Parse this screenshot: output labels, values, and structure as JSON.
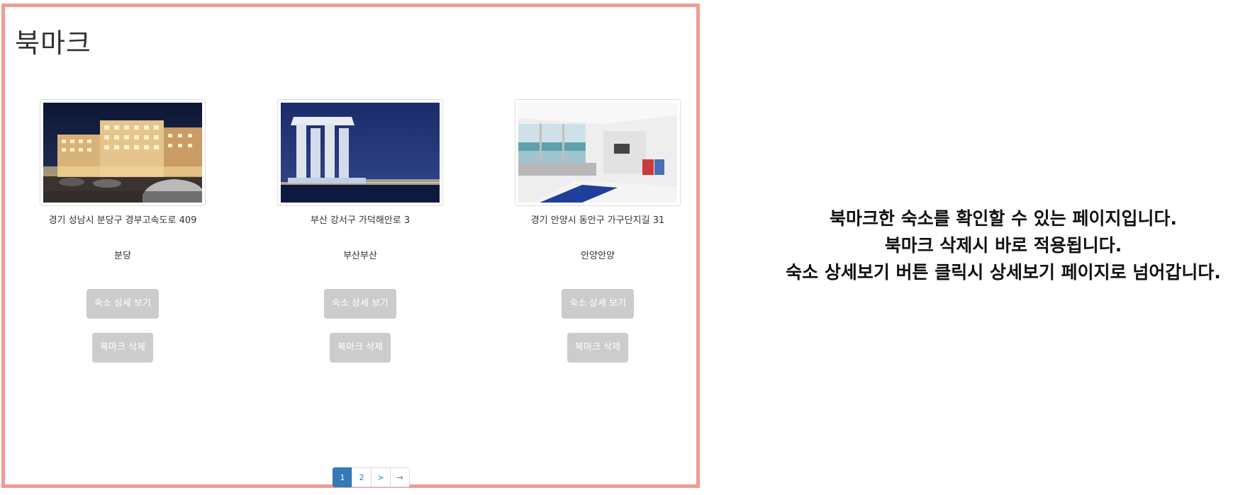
{
  "page": {
    "title": "북마크"
  },
  "bookmarks": [
    {
      "address": "경기 성남시 분당구 경부고속도로 409",
      "name": "분당",
      "detail_label": "숙소 상세 보기",
      "delete_label": "북마크 삭제",
      "image_icon": "hotel-night-photo"
    },
    {
      "address": "부산 강서구 가덕해안로 3",
      "name": "부산부산",
      "detail_label": "숙소 상세 보기",
      "delete_label": "북마크 삭제",
      "image_icon": "seaside-tower-photo"
    },
    {
      "address": "경기 안양시 동안구 가구단지길 31",
      "name": "안양안양",
      "detail_label": "숙소 상세 보기",
      "delete_label": "북마크 삭제",
      "image_icon": "ocean-view-room-photo"
    }
  ],
  "pagination": {
    "items": [
      "1",
      "2",
      ">",
      "→"
    ],
    "active": "1"
  },
  "description": {
    "lines": [
      "북마크한 숙소를 확인할 수 있는 페이지입니다.",
      "북마크 삭제시 바로 적용됩니다.",
      "숙소 상세보기 버튼 클릭시 상세보기 페이지로 넘어갑니다."
    ]
  },
  "colors": {
    "frame_border": "#ee9c96",
    "button_bg": "#cccccc",
    "pagination_active": "#337ab7"
  }
}
